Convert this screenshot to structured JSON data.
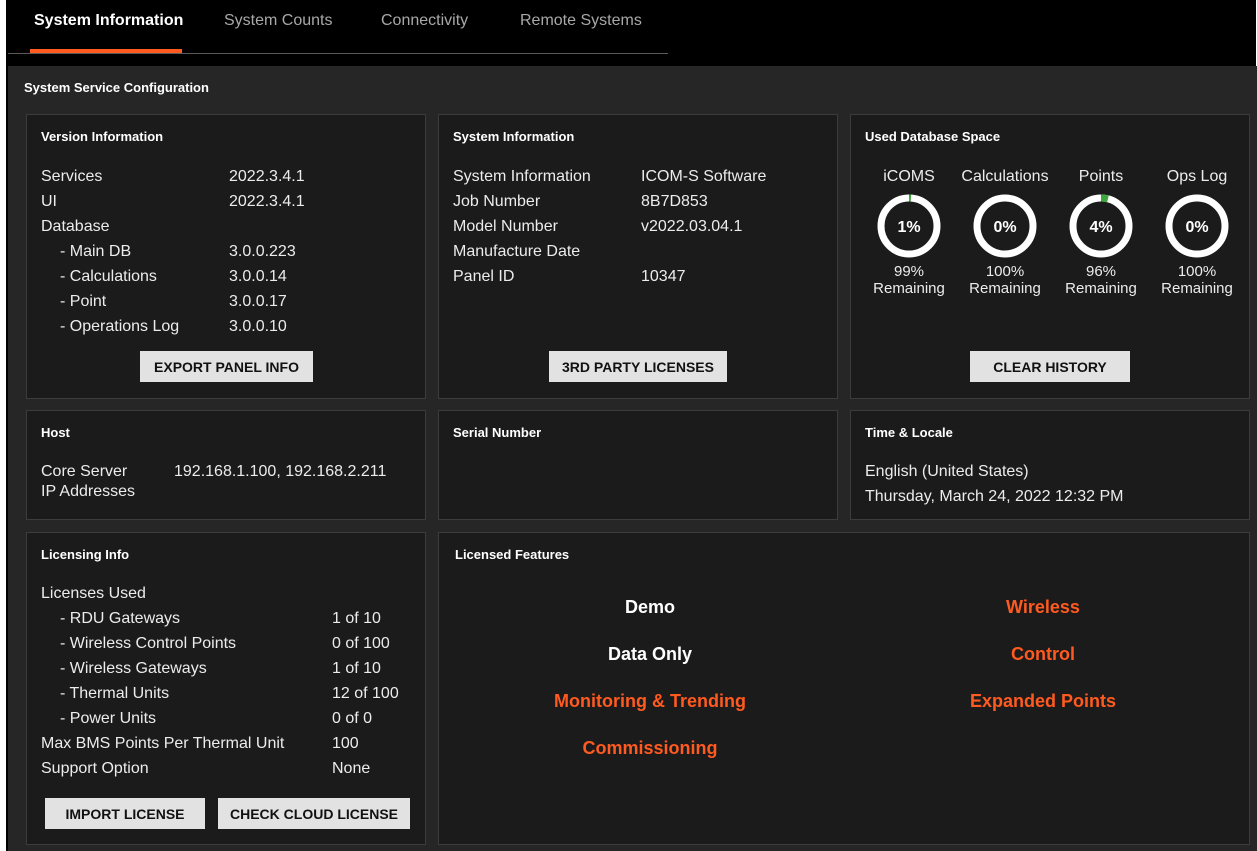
{
  "tabs": [
    {
      "label": "System Information",
      "active": true
    },
    {
      "label": "System Counts",
      "active": false
    },
    {
      "label": "Connectivity",
      "active": false
    },
    {
      "label": "Remote Systems",
      "active": false
    }
  ],
  "section_title": "System Service Configuration",
  "colors": {
    "accent": "#ff5a1f",
    "gauge_track": "#ffffff",
    "gauge_fill": "#3ea83e",
    "feature_enabled": "#ffffff",
    "feature_disabled": "#ff5a1f"
  },
  "version_info": {
    "title": "Version Information",
    "rows": [
      {
        "label": "Services",
        "value": "2022.3.4.1"
      },
      {
        "label": "UI",
        "value": "2022.3.4.1"
      },
      {
        "label": "Database",
        "value": ""
      },
      {
        "label": "- Main DB",
        "value": "3.0.0.223"
      },
      {
        "label": "- Calculations",
        "value": "3.0.0.14"
      },
      {
        "label": "- Point",
        "value": "3.0.0.17"
      },
      {
        "label": "- Operations Log",
        "value": "3.0.0.10"
      }
    ],
    "button": "EXPORT PANEL INFO"
  },
  "system_info": {
    "title": "System Information",
    "rows": [
      {
        "label": "System Information",
        "value": "ICOM-S Software"
      },
      {
        "label": "Job Number",
        "value": "8B7D853"
      },
      {
        "label": "Model Number",
        "value": "v2022.03.04.1"
      },
      {
        "label": "Manufacture Date",
        "value": ""
      },
      {
        "label": "Panel ID",
        "value": "10347"
      }
    ],
    "button": "3RD PARTY LICENSES"
  },
  "db_space": {
    "title": "Used Database Space",
    "gauges": [
      {
        "label": "iCOMS",
        "used_percent": 1,
        "percent_text": "1%",
        "remaining_pct": "99%",
        "remaining_word": "Remaining"
      },
      {
        "label": "Calculations",
        "used_percent": 0,
        "percent_text": "0%",
        "remaining_pct": "100%",
        "remaining_word": "Remaining"
      },
      {
        "label": "Points",
        "used_percent": 4,
        "percent_text": "4%",
        "remaining_pct": "96%",
        "remaining_word": "Remaining"
      },
      {
        "label": "Ops Log",
        "used_percent": 0,
        "percent_text": "0%",
        "remaining_pct": "100%",
        "remaining_word": "Remaining"
      }
    ],
    "button": "CLEAR HISTORY"
  },
  "host": {
    "title": "Host",
    "label_line1": "Core Server",
    "label_line2": "IP Addresses",
    "value": "192.168.1.100, 192.168.2.211"
  },
  "serial": {
    "title": "Serial Number"
  },
  "time_locale": {
    "title": "Time & Locale",
    "locale": "English (United States)",
    "datetime": "Thursday, March 24, 2022 12:32 PM"
  },
  "licensing": {
    "title": "Licensing Info",
    "rows": [
      {
        "label": "Licenses Used",
        "value": ""
      },
      {
        "label": "- RDU Gateways",
        "value": "1 of 10"
      },
      {
        "label": "- Wireless Control Points",
        "value": "0 of 100"
      },
      {
        "label": "- Wireless Gateways",
        "value": "1 of 10"
      },
      {
        "label": "- Thermal Units",
        "value": "12 of 100"
      },
      {
        "label": "- Power Units",
        "value": "0 of 0"
      },
      {
        "label": "Max BMS Points Per Thermal Unit",
        "value": "100"
      },
      {
        "label": "Support Option",
        "value": "None"
      }
    ],
    "import_button": "IMPORT LICENSE",
    "cloud_button": "CHECK CLOUD LICENSE"
  },
  "features": {
    "title": "Licensed Features",
    "items": [
      {
        "label": "Demo",
        "enabled": true
      },
      {
        "label": "Wireless",
        "enabled": false
      },
      {
        "label": "Data Only",
        "enabled": true
      },
      {
        "label": "Control",
        "enabled": false
      },
      {
        "label": "Monitoring & Trending",
        "enabled": false
      },
      {
        "label": "Expanded Points",
        "enabled": false
      },
      {
        "label": "Commissioning",
        "enabled": false
      }
    ]
  }
}
